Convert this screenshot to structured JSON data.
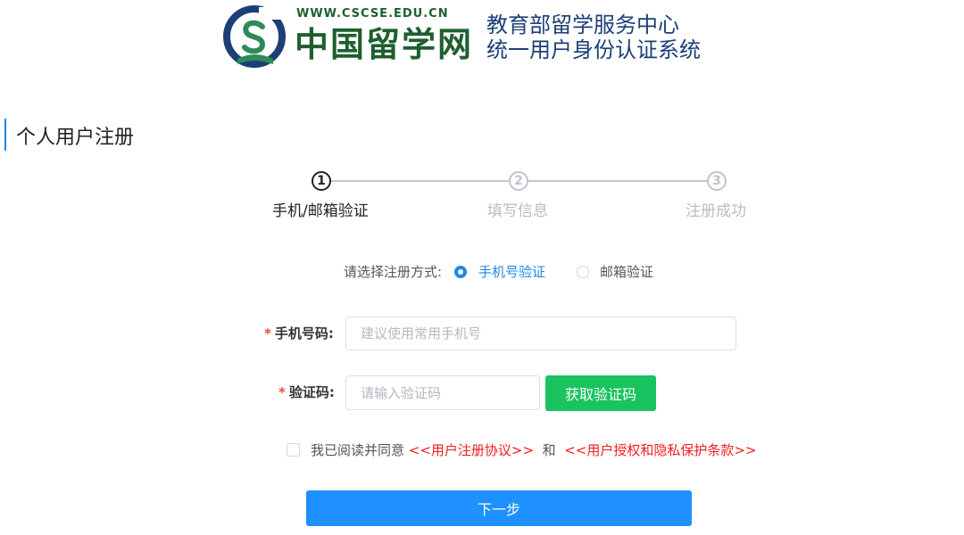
{
  "header": {
    "site_url": "WWW.CSCSE.EDU.CN",
    "site_name": "中国留学网",
    "org_name": "教育部留学服务中心",
    "system_name": "统一用户身份认证系统",
    "brand_color": "#1f5f2e",
    "system_color": "#1d3f78"
  },
  "page": {
    "title": "个人用户注册"
  },
  "steps": [
    {
      "number": "1",
      "label": "手机/邮箱验证",
      "active": true
    },
    {
      "number": "2",
      "label": "填写信息",
      "active": false
    },
    {
      "number": "3",
      "label": "注册成功",
      "active": false
    }
  ],
  "register_method": {
    "label": "请选择注册方式:",
    "options": [
      {
        "label": "手机号验证",
        "selected": true
      },
      {
        "label": "邮箱验证",
        "selected": false
      }
    ]
  },
  "form": {
    "required_mark": "*",
    "phone": {
      "label": "手机号码:",
      "placeholder": "建议使用常用手机号",
      "value": ""
    },
    "code": {
      "label": "验证码:",
      "placeholder": "请输入验证码",
      "value": "",
      "button": "获取验证码"
    }
  },
  "agreement": {
    "checked": false,
    "prefix": "我已阅读并同意",
    "link1": "<<用户注册协议>>",
    "conjunction": "和",
    "link2": "<<用户授权和隐私保护条款>>"
  },
  "actions": {
    "next": "下一步"
  },
  "colors": {
    "accent": "#1e90ff",
    "success": "#19c35f",
    "link_red": "#f01e1e",
    "required": "#f0493e"
  }
}
